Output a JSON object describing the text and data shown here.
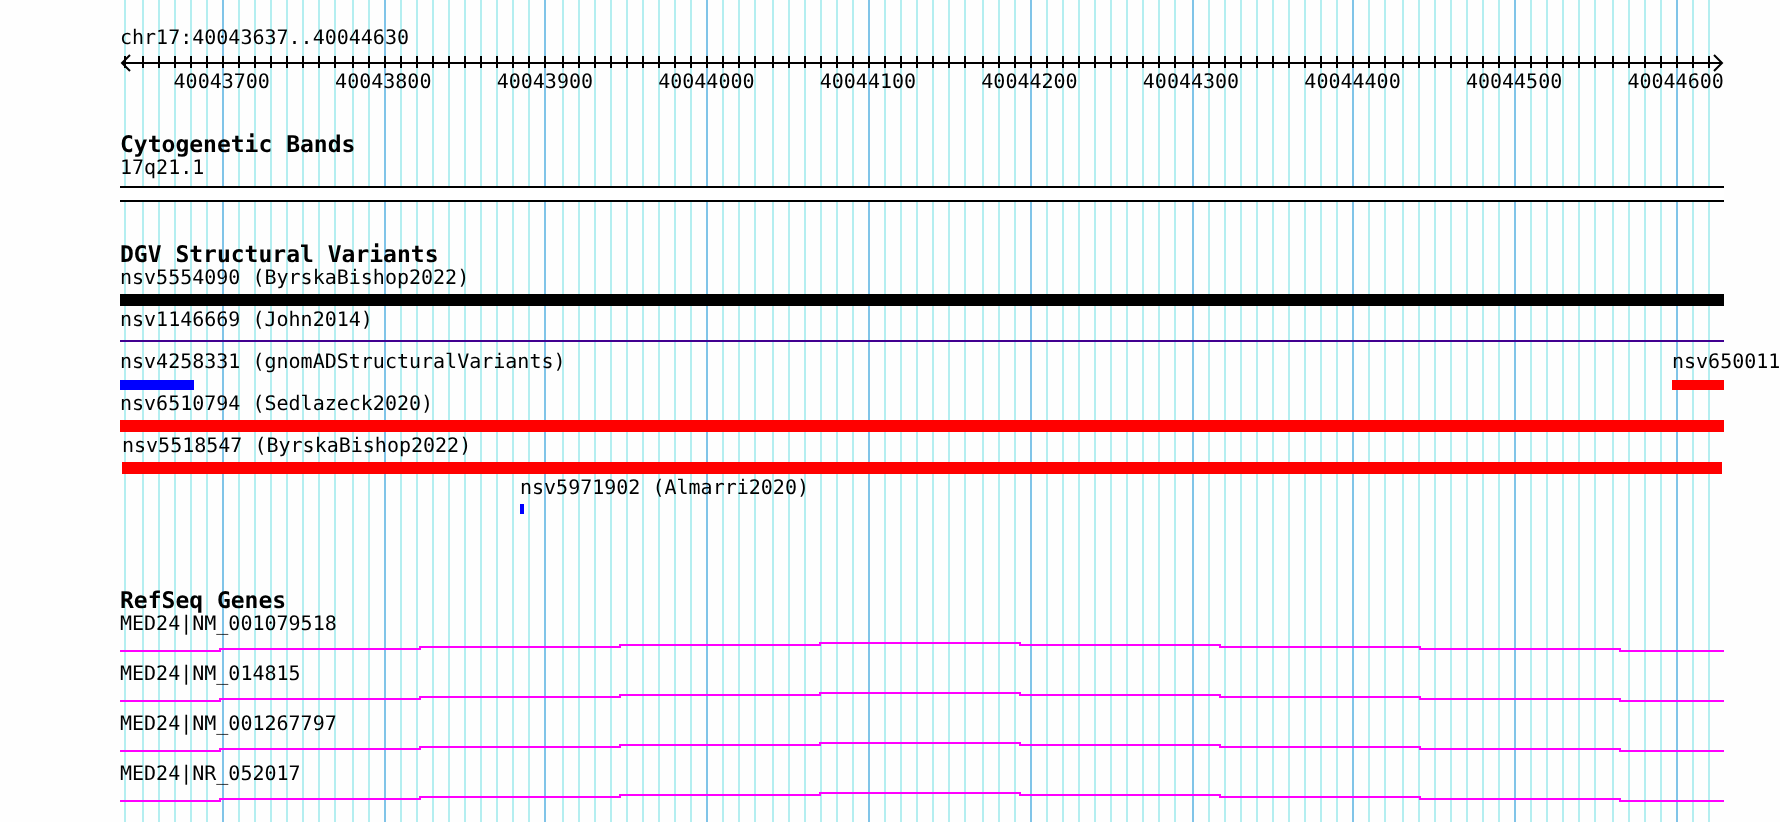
{
  "location": "chr17:40043637..40044630",
  "ruler": {
    "ticks": [
      "40043700",
      "40043800",
      "40043900",
      "40044000",
      "40044100",
      "40044200",
      "40044300",
      "40044400",
      "40044500",
      "40044600"
    ]
  },
  "tracks": [
    {
      "kind": "bands",
      "title": "Cytogenetic Bands",
      "features": [
        {
          "label": "17q21.1"
        }
      ]
    },
    {
      "kind": "variants",
      "title": "DGV Structural Variants",
      "rows": [
        [
          {
            "label": "nsv5554090 (ByrskaBishop2022)",
            "color": "#000000"
          }
        ],
        [
          {
            "label": "nsv1146669 (John2014)",
            "color": "#400090"
          }
        ],
        [
          {
            "label": "nsv4258331 (gnomADStructuralVariants)",
            "color": "#0000ff"
          },
          {
            "label": "nsv650011",
            "color": "#ff0000"
          }
        ],
        [
          {
            "label": "nsv6510794 (Sedlazeck2020)",
            "color": "#ff0000"
          }
        ],
        [
          {
            "label": "nsv5518547 (ByrskaBishop2022)",
            "color": "#ff0000"
          }
        ],
        [
          {
            "label": "nsv5971902 (Almarri2020)",
            "color": "#0000ff"
          }
        ]
      ]
    },
    {
      "kind": "genes",
      "title": "RefSeq Genes",
      "features": [
        {
          "label": "MED24|NM_001079518"
        },
        {
          "label": "MED24|NM_014815"
        },
        {
          "label": "MED24|NM_001267797"
        },
        {
          "label": "MED24|NR_052017"
        }
      ]
    }
  ]
}
